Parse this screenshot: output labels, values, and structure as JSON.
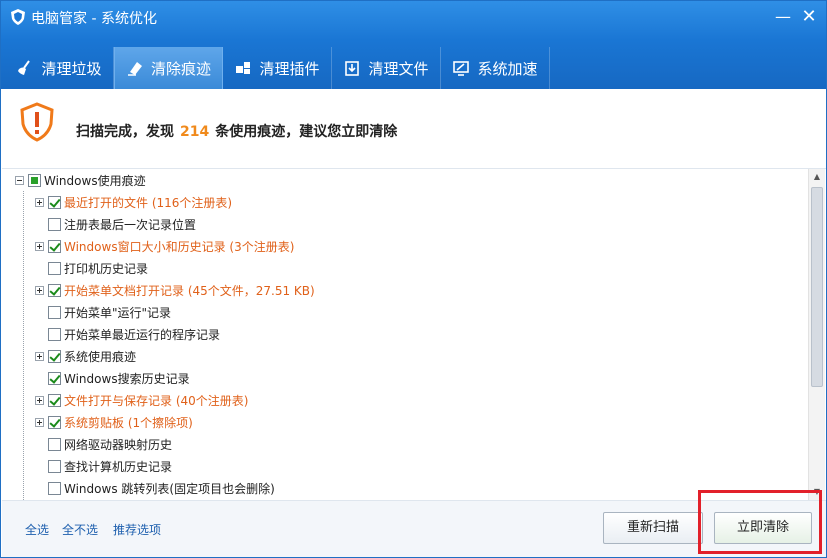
{
  "window": {
    "title": "电脑管家 - 系统优化"
  },
  "tabs": [
    {
      "label": "清理垃圾",
      "icon": "broom-icon"
    },
    {
      "label": "清除痕迹",
      "icon": "eraser-icon"
    },
    {
      "label": "清理插件",
      "icon": "puzzle-icon"
    },
    {
      "label": "清理文件",
      "icon": "file-box-icon"
    },
    {
      "label": "系统加速",
      "icon": "monitor-icon"
    }
  ],
  "banner": {
    "prefix": "扫描完成，发现",
    "count": "214",
    "suffix": "条使用痕迹，建议您立即清除"
  },
  "tree": {
    "root": "Windows使用痕迹",
    "items": [
      {
        "label": "最近打开的文件 (116个注册表)",
        "checked": true,
        "expandable": true,
        "warn": true
      },
      {
        "label": "注册表最后一次记录位置",
        "checked": false,
        "expandable": false,
        "warn": false
      },
      {
        "label": "Windows窗口大小和历史记录 (3个注册表)",
        "checked": true,
        "expandable": true,
        "warn": true
      },
      {
        "label": "打印机历史记录",
        "checked": false,
        "expandable": false,
        "warn": false
      },
      {
        "label": "开始菜单文档打开记录 (45个文件，27.51 KB)",
        "checked": true,
        "expandable": true,
        "warn": true
      },
      {
        "label": "开始菜单\"运行\"记录",
        "checked": false,
        "expandable": false,
        "warn": false
      },
      {
        "label": "开始菜单最近运行的程序记录",
        "checked": false,
        "expandable": false,
        "warn": false
      },
      {
        "label": "系统使用痕迹",
        "checked": true,
        "expandable": true,
        "warn": false
      },
      {
        "label": "Windows搜索历史记录",
        "checked": true,
        "expandable": false,
        "warn": false
      },
      {
        "label": "文件打开与保存记录 (40个注册表)",
        "checked": true,
        "expandable": true,
        "warn": true
      },
      {
        "label": "系统剪贴板 (1个擦除项)",
        "checked": true,
        "expandable": true,
        "warn": true
      },
      {
        "label": "网络驱动器映射历史",
        "checked": false,
        "expandable": false,
        "warn": false
      },
      {
        "label": "查找计算机历史记录",
        "checked": false,
        "expandable": false,
        "warn": false
      },
      {
        "label": "Windows 跳转列表(固定项目也会删除)",
        "checked": false,
        "expandable": false,
        "warn": false
      }
    ]
  },
  "footer": {
    "select_all": "全选",
    "select_none": "全不选",
    "recommended": "推荐选项",
    "rescan": "重新扫描",
    "clean_now": "立即清除"
  },
  "colors": {
    "accent": "#1a76d4",
    "warning": "#e0611a",
    "count": "#f08a1c",
    "highlight": "#e2202a"
  }
}
